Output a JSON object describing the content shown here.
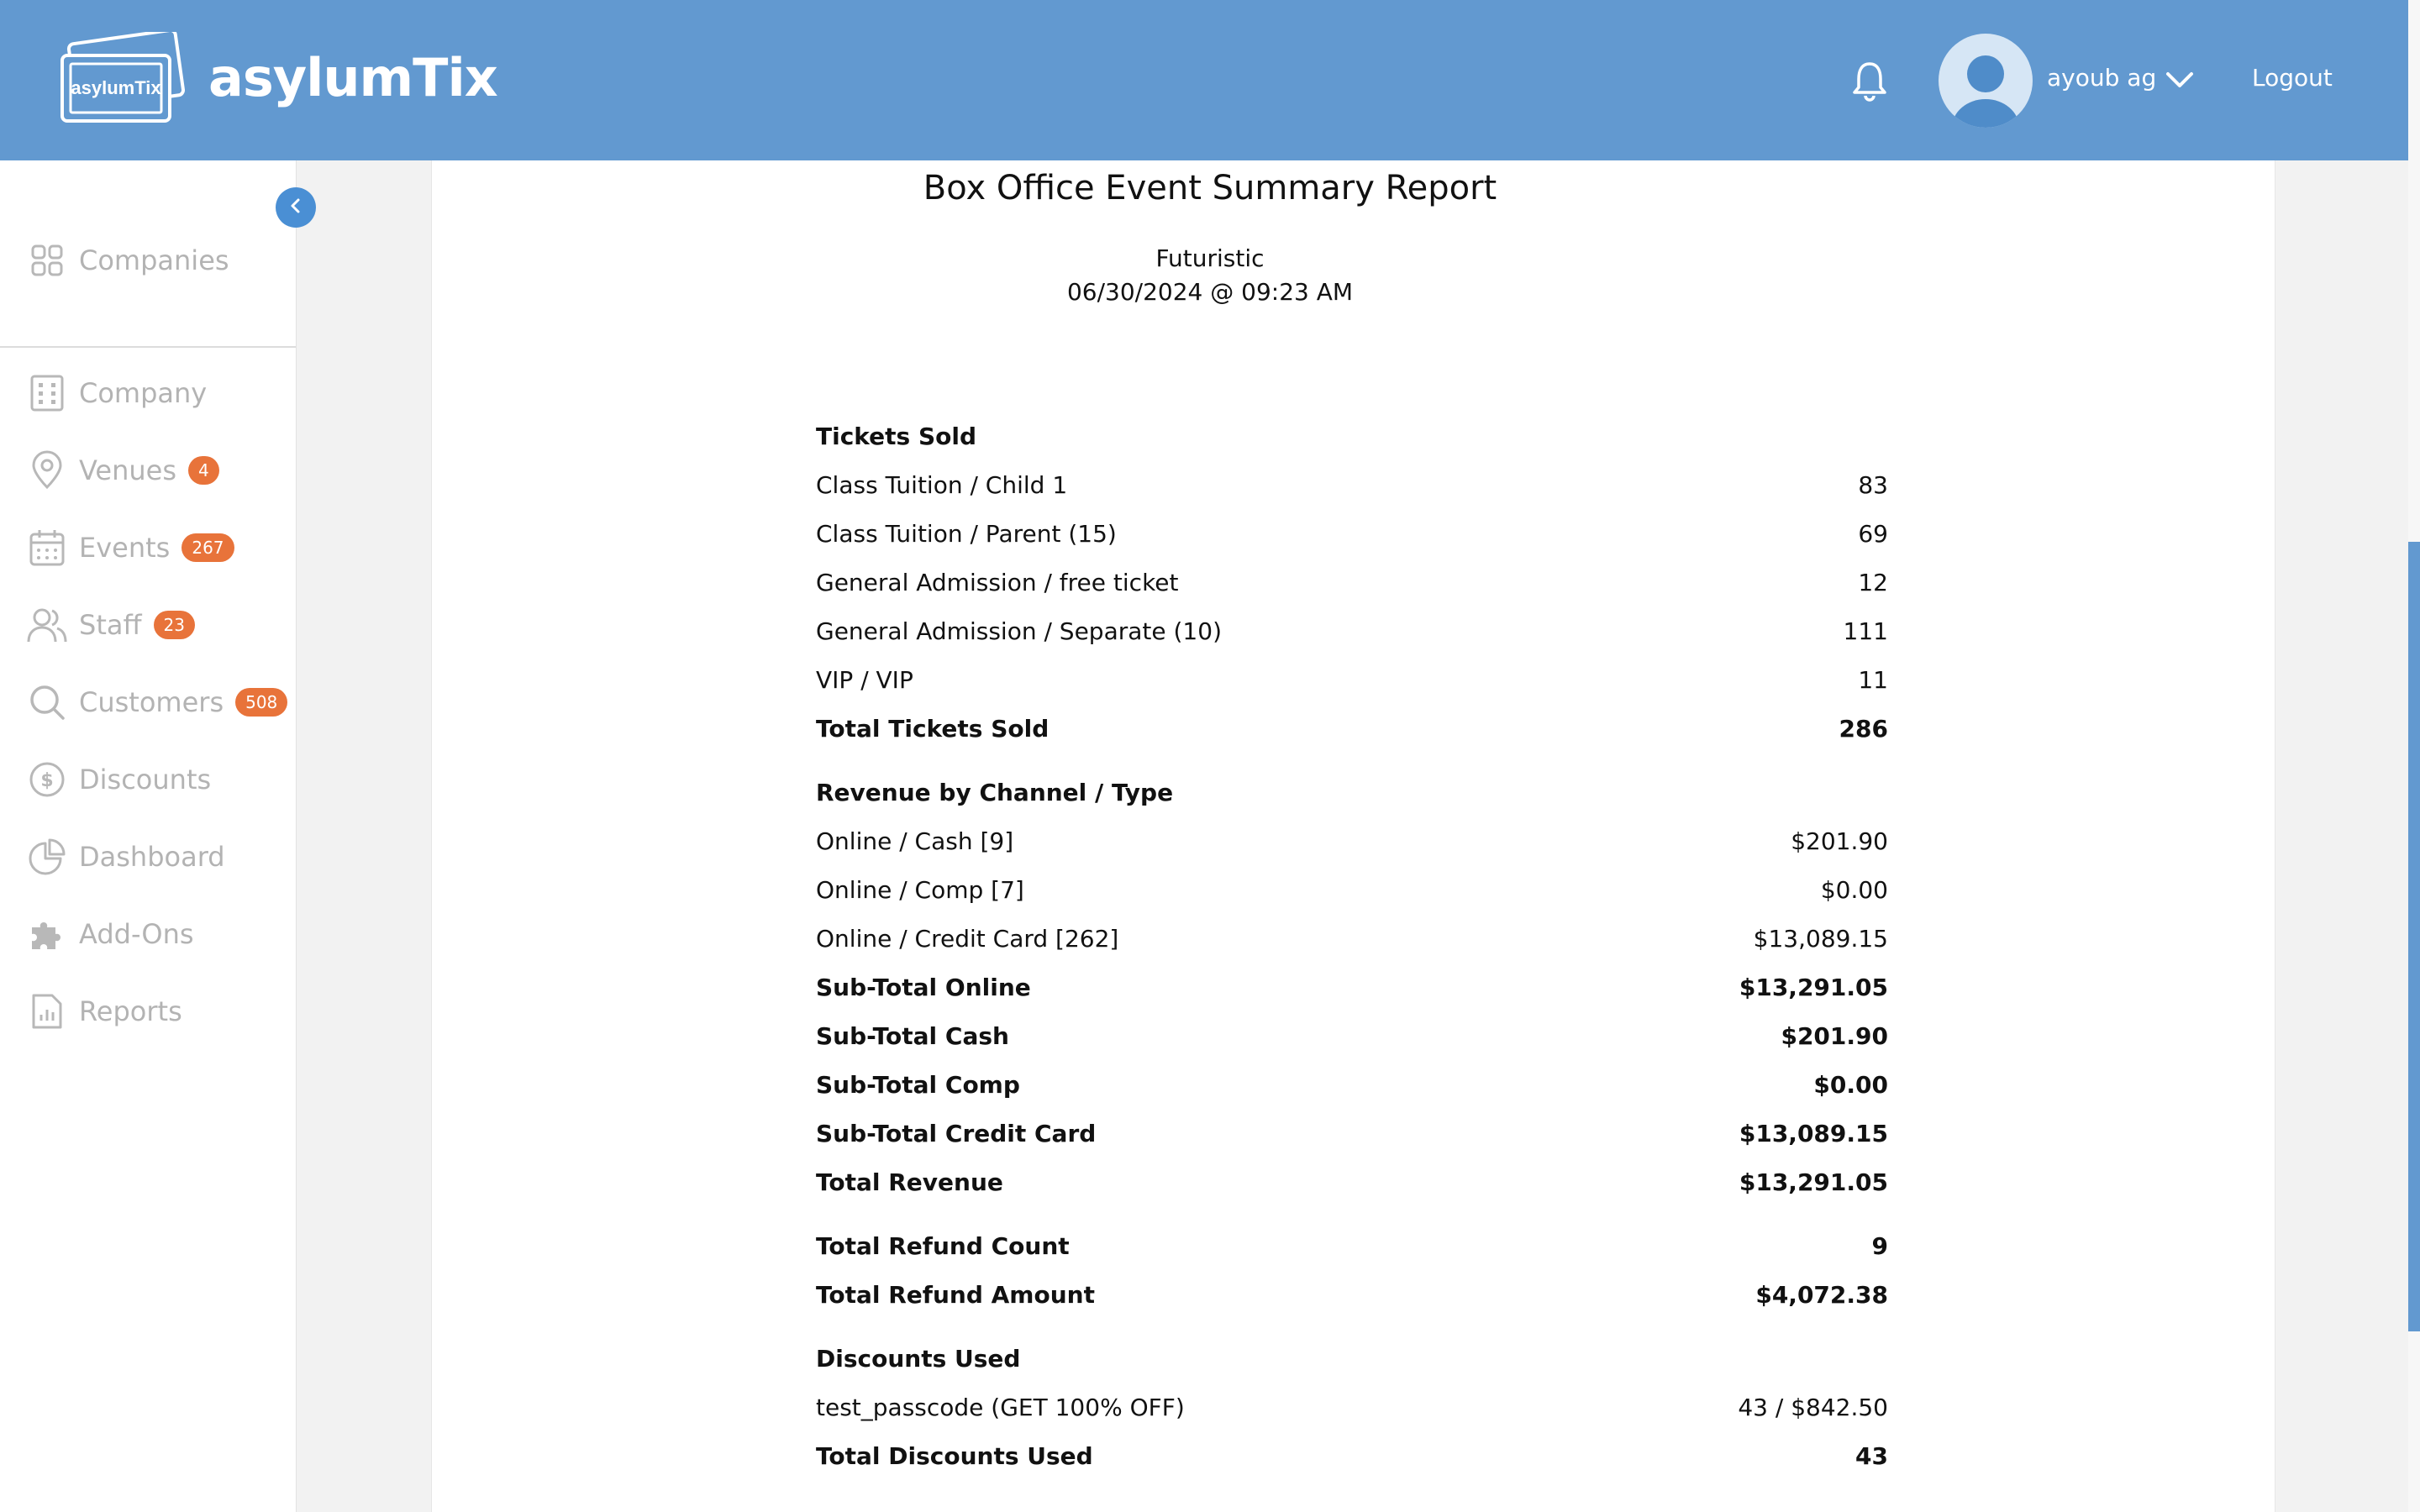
{
  "header": {
    "logo_badge": "asylumTix",
    "app_name": "asylumTix",
    "user_name": "ayoub ag",
    "logout_label": "Logout"
  },
  "sidebar": {
    "companies_label": "Companies",
    "items": [
      {
        "label": "Company",
        "icon": "building-icon",
        "badge": ""
      },
      {
        "label": "Venues",
        "icon": "map-pin-icon",
        "badge": "4"
      },
      {
        "label": "Events",
        "icon": "calendar-icon",
        "badge": "267"
      },
      {
        "label": "Staff",
        "icon": "users-icon",
        "badge": "23"
      },
      {
        "label": "Customers",
        "icon": "search-icon",
        "badge": "508"
      },
      {
        "label": "Discounts",
        "icon": "dollar-circle-icon",
        "badge": ""
      },
      {
        "label": "Dashboard",
        "icon": "pie-chart-icon",
        "badge": ""
      },
      {
        "label": "Add-Ons",
        "icon": "puzzle-icon",
        "badge": ""
      },
      {
        "label": "Reports",
        "icon": "report-icon",
        "badge": ""
      }
    ]
  },
  "report": {
    "title": "Box Office Event Summary Report",
    "event_name": "Futuristic",
    "datetime": "06/30/2024 @ 09:23 AM",
    "tickets_sold_heading": "Tickets Sold",
    "tickets": [
      {
        "label": "Class Tuition / Child 1",
        "value": "83"
      },
      {
        "label": "Class Tuition / Parent (15)",
        "value": "69"
      },
      {
        "label": "General Admission / free ticket",
        "value": "12"
      },
      {
        "label": "General Admission / Separate (10)",
        "value": "111"
      },
      {
        "label": "VIP / VIP",
        "value": "11"
      }
    ],
    "total_tickets": {
      "label": "Total Tickets Sold",
      "value": "286"
    },
    "revenue_heading": "Revenue by Channel / Type",
    "revenue": [
      {
        "label": "Online / Cash [9]",
        "value": "$201.90"
      },
      {
        "label": "Online / Comp [7]",
        "value": "$0.00"
      },
      {
        "label": "Online / Credit Card [262]",
        "value": "$13,089.15"
      }
    ],
    "subtotals": [
      {
        "label": "Sub-Total Online",
        "value": "$13,291.05"
      },
      {
        "label": "Sub-Total Cash",
        "value": "$201.90"
      },
      {
        "label": "Sub-Total Comp",
        "value": "$0.00"
      },
      {
        "label": "Sub-Total Credit Card",
        "value": "$13,089.15"
      },
      {
        "label": "Total Revenue",
        "value": "$13,291.05"
      }
    ],
    "refunds": [
      {
        "label": "Total Refund Count",
        "value": "9"
      },
      {
        "label": "Total Refund Amount",
        "value": "$4,072.38"
      }
    ],
    "discounts_heading": "Discounts Used",
    "discounts": [
      {
        "label": "test_passcode (GET 100% OFF)",
        "value": "43 / $842.50"
      }
    ],
    "total_discounts": {
      "label": "Total Discounts Used",
      "value": "43"
    }
  }
}
